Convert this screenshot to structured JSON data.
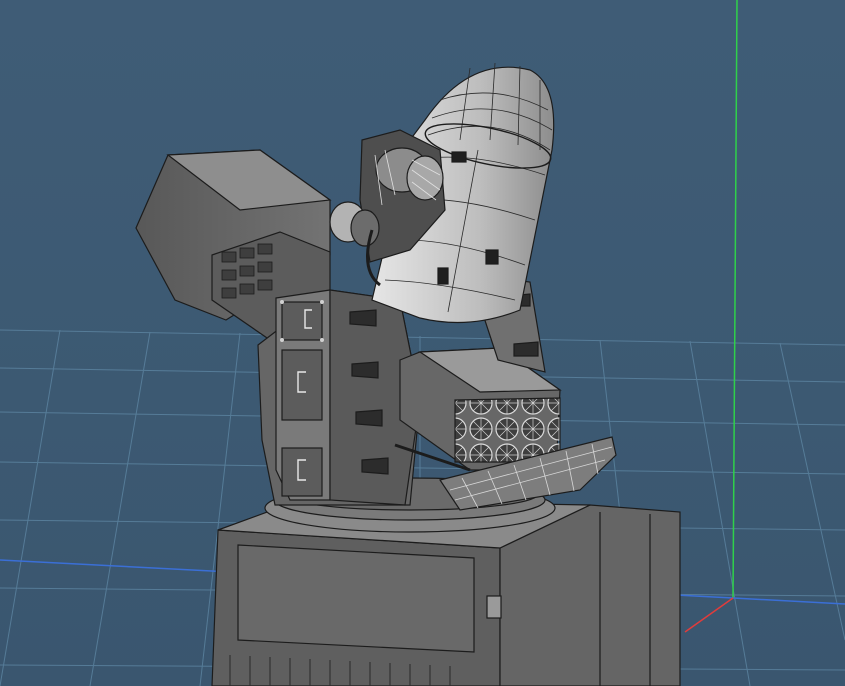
{
  "viewport": {
    "background": "#3d5a73",
    "grid_color": "#5f88a5",
    "axis_colors": {
      "x": "#3b6fd6",
      "y": "#2fd14a",
      "z": "#e03c3c"
    }
  },
  "model": {
    "base_color": "#5d5d5d",
    "panel_color": "#6f6f6f",
    "edge_color": "#1c1c1c",
    "dome_color": "#cfcfcf"
  }
}
